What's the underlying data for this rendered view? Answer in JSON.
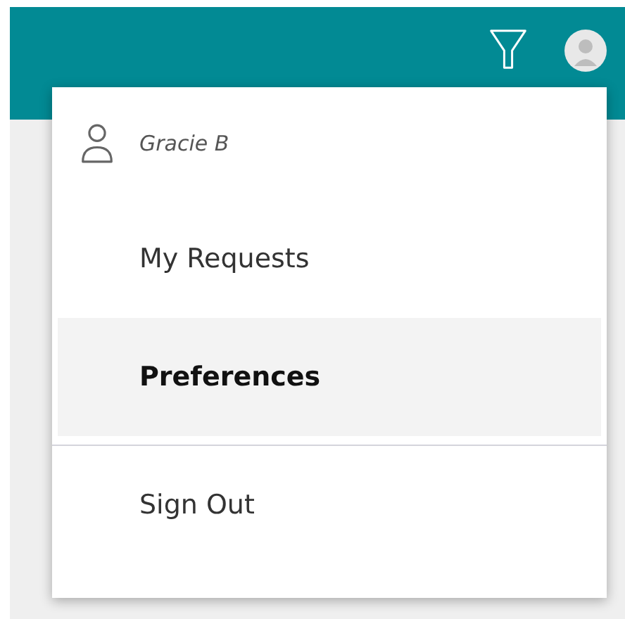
{
  "user": {
    "name": "Gracie B"
  },
  "menu": [
    {
      "label": "My Requests",
      "selected": false,
      "divider_after": false
    },
    {
      "label": "Preferences",
      "selected": true,
      "divider_after": true
    },
    {
      "label": "Sign Out",
      "selected": false,
      "divider_after": false
    }
  ]
}
